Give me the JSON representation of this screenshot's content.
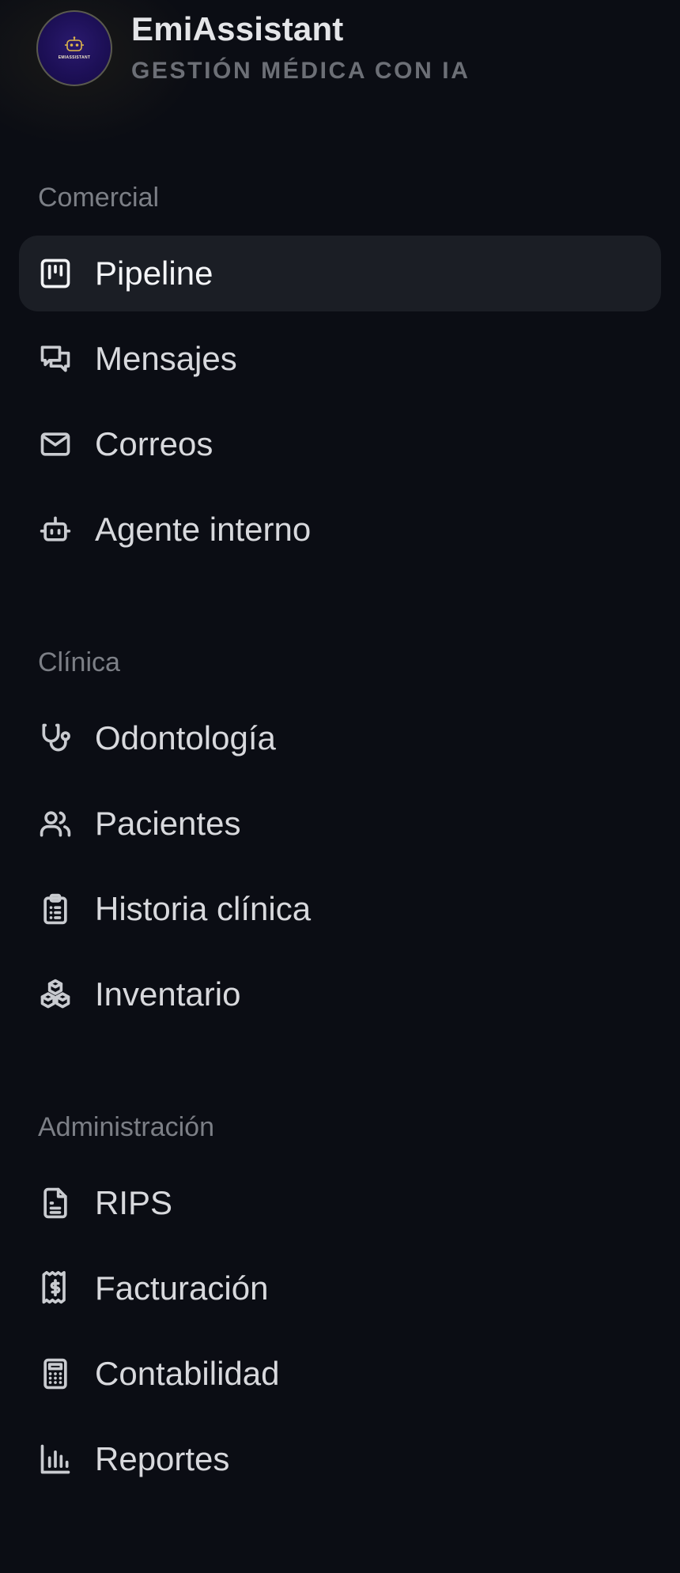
{
  "brand": {
    "logo_text": "EMIASSISTANT",
    "title": "EmiAssistant",
    "subtitle": "GESTIÓN MÉDICA CON IA"
  },
  "sections": [
    {
      "title": "Comercial",
      "items": [
        {
          "label": "Pipeline",
          "icon": "kanban-icon",
          "active": true
        },
        {
          "label": "Mensajes",
          "icon": "chat-bubbles-icon"
        },
        {
          "label": "Correos",
          "icon": "mail-icon"
        },
        {
          "label": "Agente interno",
          "icon": "robot-icon"
        }
      ]
    },
    {
      "title": "Clínica",
      "items": [
        {
          "label": "Odontología",
          "icon": "stethoscope-icon"
        },
        {
          "label": "Pacientes",
          "icon": "users-icon"
        },
        {
          "label": "Historia clínica",
          "icon": "clipboard-list-icon"
        },
        {
          "label": "Inventario",
          "icon": "boxes-icon"
        }
      ]
    },
    {
      "title": "Administración",
      "items": [
        {
          "label": "RIPS",
          "icon": "file-text-icon"
        },
        {
          "label": "Facturación",
          "icon": "receipt-dollar-icon"
        },
        {
          "label": "Contabilidad",
          "icon": "calculator-icon"
        },
        {
          "label": "Reportes",
          "icon": "bar-chart-icon"
        }
      ]
    }
  ],
  "colors": {
    "background": "#0b0d14",
    "active_item_bg": "#1b1e25",
    "section_title": "#7c7f86",
    "logo_bg": "#1c0f55"
  }
}
